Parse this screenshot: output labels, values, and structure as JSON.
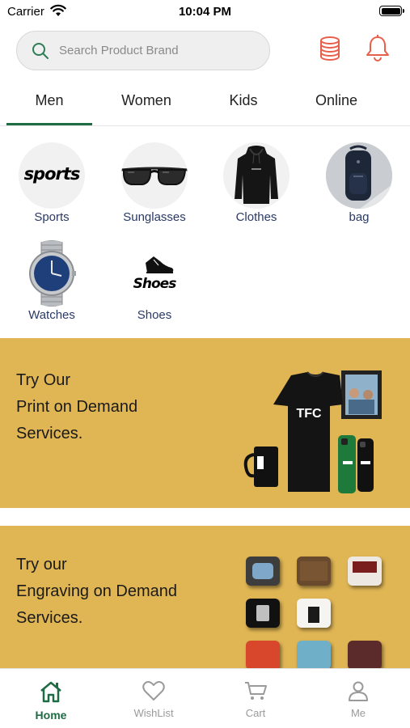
{
  "status_bar": {
    "carrier": "Carrier",
    "time": "10:04 PM"
  },
  "search": {
    "placeholder": "Search Product Brand"
  },
  "header_icons": [
    "coins-icon",
    "bell-icon"
  ],
  "accent_colors": {
    "brand_green": "#1f6b43",
    "icon_red": "#e8604a",
    "banner_gold": "#e0b654",
    "category_label": "#2a3a66"
  },
  "tabs": [
    {
      "label": "Men",
      "selected": true
    },
    {
      "label": "Women",
      "selected": false
    },
    {
      "label": "Kids",
      "selected": false
    },
    {
      "label": "Online",
      "selected": false
    }
  ],
  "categories": [
    {
      "label": "Sports",
      "logo_text": "sports"
    },
    {
      "label": "Sunglasses"
    },
    {
      "label": "Clothes"
    },
    {
      "label": "bag"
    },
    {
      "label": "Watches"
    },
    {
      "label": "Shoes",
      "logo_text": "Shoes"
    }
  ],
  "banners": {
    "print": {
      "line1": "Try Our",
      "line2": "Print on Demand",
      "line3": "Services.",
      "logo_text": "TFC"
    },
    "engrave": {
      "line1": "Try our",
      "line2": "Engraving on Demand",
      "line3": "Services."
    }
  },
  "bottom_nav": [
    {
      "label": "Home",
      "icon": "home-icon",
      "active": true
    },
    {
      "label": "WishList",
      "icon": "heart-icon",
      "active": false
    },
    {
      "label": "Cart",
      "icon": "cart-icon",
      "active": false
    },
    {
      "label": "Me",
      "icon": "person-icon",
      "active": false
    }
  ]
}
